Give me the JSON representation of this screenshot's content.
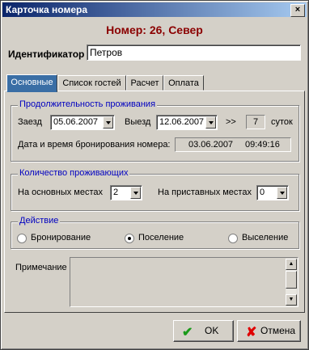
{
  "window": {
    "title": "Карточка номера",
    "close_glyph": "×"
  },
  "heading": "Номер: 26, Север",
  "identifier": {
    "label": "Идентификатор",
    "value": "Петров"
  },
  "tabs": [
    {
      "label": "Основные",
      "active": true
    },
    {
      "label": "Список гостей"
    },
    {
      "label": "Расчет"
    },
    {
      "label": "Оплата"
    }
  ],
  "stay": {
    "title": "Продолжительность проживания",
    "checkin_label": "Заезд",
    "checkin_value": "05.06.2007",
    "checkout_label": "Выезд",
    "checkout_value": "12.06.2007",
    "arrows": ">>",
    "days_value": "7",
    "days_unit": "суток",
    "booking_label": "Дата и время бронирования номера:",
    "booking_date": "03.06.2007",
    "booking_time": "09:49:16"
  },
  "guests": {
    "title": "Количество проживающих",
    "main_label": "На основных местах",
    "main_value": "2",
    "extra_label": "На приставных местах",
    "extra_value": "0"
  },
  "action": {
    "title": "Действие",
    "options": [
      "Бронирование",
      "Поселение",
      "Выселение"
    ],
    "selected": "Поселение"
  },
  "note": {
    "label": "Примечание",
    "value": ""
  },
  "buttons": {
    "ok": "OK",
    "cancel": "Отмена"
  },
  "colors": {
    "heading": "#8b0000",
    "group_title": "#0000c0",
    "active_tab": "#3a6ea5",
    "ok_icon": "#1a9a1a",
    "cancel_icon": "#e00000"
  }
}
